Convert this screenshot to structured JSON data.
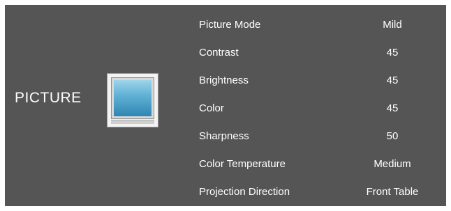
{
  "section": {
    "title": "PICTURE",
    "icon": "picture-monitor-icon"
  },
  "menu": {
    "items": [
      {
        "label": "Picture Mode",
        "value": "Mild"
      },
      {
        "label": "Contrast",
        "value": "45"
      },
      {
        "label": "Brightness",
        "value": "45"
      },
      {
        "label": "Color",
        "value": "45"
      },
      {
        "label": "Sharpness",
        "value": "50"
      },
      {
        "label": "Color Temperature",
        "value": "Medium"
      },
      {
        "label": "Projection Direction",
        "value": "Front Table"
      }
    ]
  },
  "colors": {
    "panel_background": "#555555",
    "text": "#ffffff",
    "icon_screen": "#3a92bf"
  }
}
